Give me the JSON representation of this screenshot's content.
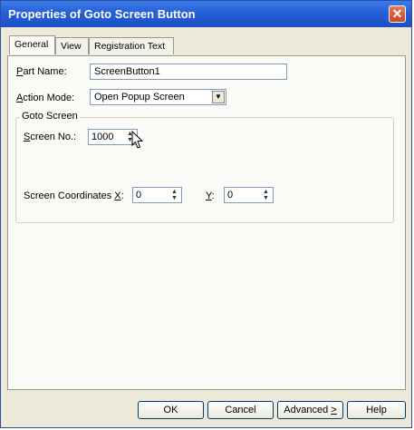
{
  "window": {
    "title": "Properties of Goto Screen Button",
    "close": "✕"
  },
  "tabs": [
    {
      "label": "General"
    },
    {
      "label": "View"
    },
    {
      "label": "Registration Text"
    }
  ],
  "general": {
    "part_name_label_key": "P",
    "part_name_label_rest": "art Name:",
    "part_name_value": "ScreenButton1",
    "action_mode_label_key": "A",
    "action_mode_label_rest": "ction Mode:",
    "action_mode_value": "Open Popup Screen",
    "goto_group_title": "Goto Screen",
    "screen_no_label_key": "S",
    "screen_no_label_rest": "creen No.:",
    "screen_no_value": "1000",
    "coords_label": "Screen Coordinates",
    "x_label": "X",
    "x_suffix": ":",
    "x_value": "0",
    "y_label": "Y",
    "y_suffix": ":",
    "y_value": "0"
  },
  "buttons": {
    "ok": "OK",
    "cancel": "Cancel",
    "advanced": "Advanced",
    "advanced_key": ">",
    "help": "Help"
  }
}
